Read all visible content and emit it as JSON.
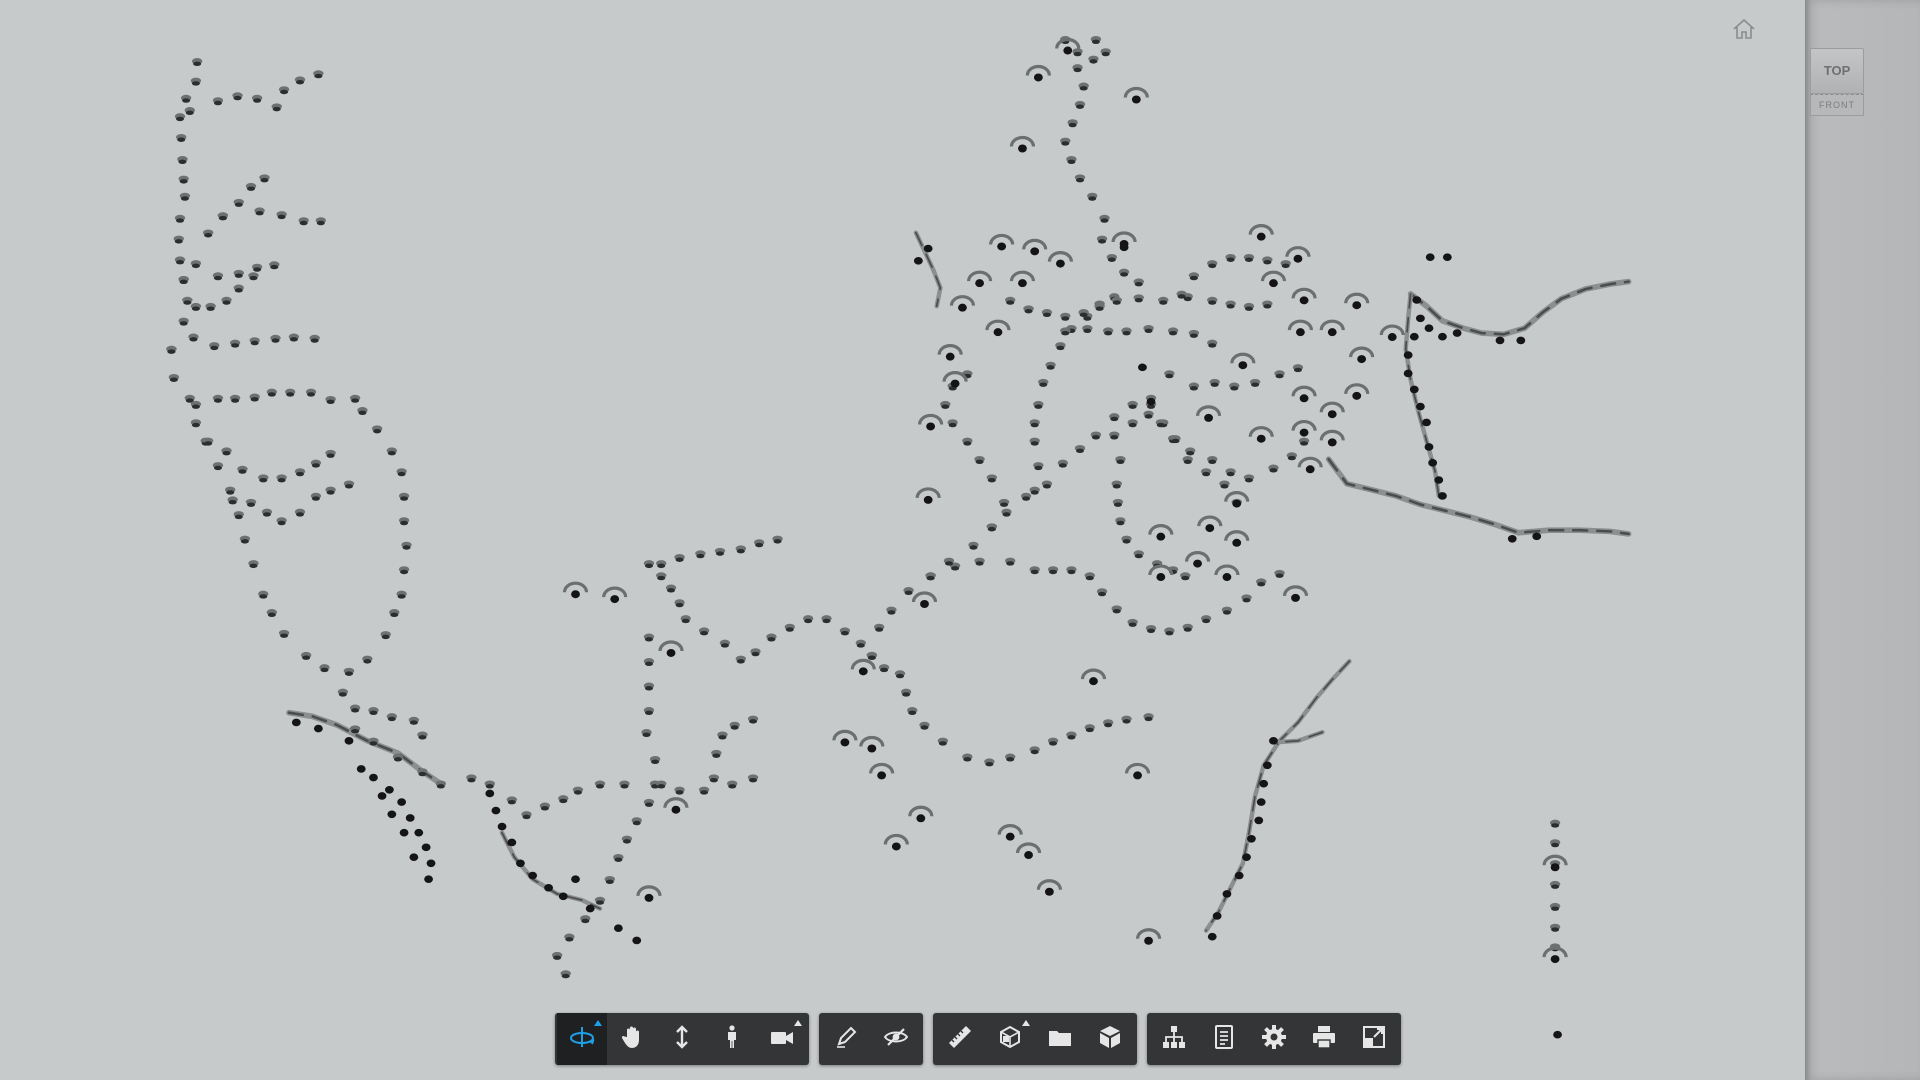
{
  "viewcube": {
    "top_label": "TOP",
    "front_label": "FRONT"
  },
  "toolbar": {
    "groups": [
      {
        "name": "navigation",
        "tools": [
          {
            "id": "orbit",
            "icon": "orbit-icon",
            "active": true,
            "flyout": true
          },
          {
            "id": "pan",
            "icon": "hand-icon",
            "active": false,
            "flyout": false
          },
          {
            "id": "zoom",
            "icon": "zoom-updown-icon",
            "active": false,
            "flyout": false
          },
          {
            "id": "first-person",
            "icon": "person-icon",
            "active": false,
            "flyout": false
          },
          {
            "id": "camera",
            "icon": "camera-icon",
            "active": false,
            "flyout": true
          }
        ]
      },
      {
        "name": "review",
        "tools": [
          {
            "id": "markup",
            "icon": "pencil-icon",
            "active": false,
            "flyout": false
          },
          {
            "id": "hide",
            "icon": "eye-slash-icon",
            "active": false,
            "flyout": false
          }
        ]
      },
      {
        "name": "analysis",
        "tools": [
          {
            "id": "measure",
            "icon": "ruler-icon",
            "active": false,
            "flyout": false
          },
          {
            "id": "section",
            "icon": "section-box-icon",
            "active": false,
            "flyout": true
          },
          {
            "id": "explode",
            "icon": "folder-icon",
            "active": false,
            "flyout": false
          },
          {
            "id": "model",
            "icon": "cube-icon",
            "active": false,
            "flyout": false
          }
        ]
      },
      {
        "name": "settings",
        "tools": [
          {
            "id": "model-browser",
            "icon": "hierarchy-icon",
            "active": false,
            "flyout": false
          },
          {
            "id": "properties",
            "icon": "properties-icon",
            "active": false,
            "flyout": false
          },
          {
            "id": "settings",
            "icon": "gear-icon",
            "active": false,
            "flyout": false
          },
          {
            "id": "print",
            "icon": "printer-icon",
            "active": false,
            "flyout": false
          },
          {
            "id": "fullscreen",
            "icon": "fullscreen-icon",
            "active": false,
            "flyout": false
          }
        ]
      }
    ]
  },
  "colors": {
    "viewport_bg": "#c7cacb",
    "toolbar_bg": "#343536",
    "icon": "#e6e6e6",
    "active_icon": "#1ea0e8"
  }
}
